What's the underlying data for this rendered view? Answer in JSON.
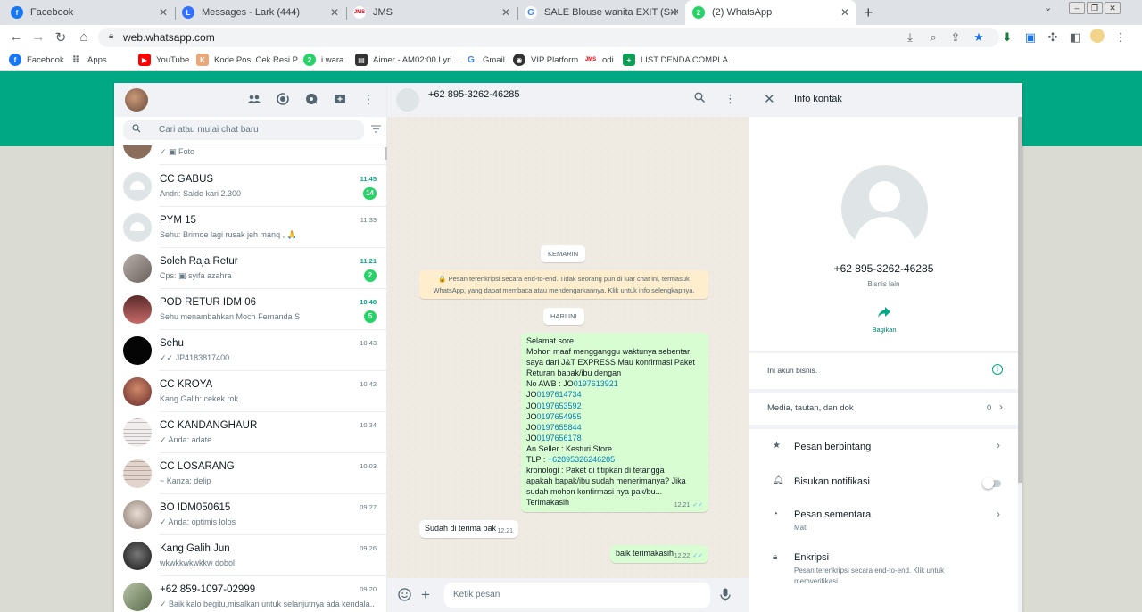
{
  "browser": {
    "tabs": [
      {
        "label": "Facebook",
        "favicon": "facebook-icon",
        "color": "#1877f2"
      },
      {
        "label": "Messages - Lark (444)",
        "favicon": "lark-icon",
        "color": "#3370ff"
      },
      {
        "label": "JMS",
        "favicon": "jms-icon",
        "color": "#e60012"
      },
      {
        "label": "SALE Blouse wanita EXIT (S-XXL),S",
        "favicon": "google-icon",
        "color": "#4285f4"
      },
      {
        "label": "(2) WhatsApp",
        "favicon": "whatsapp-icon",
        "color": "#25d366"
      }
    ],
    "url": "web.whatsapp.com",
    "bookmarks": [
      {
        "label": "Facebook",
        "icon": "facebook-icon",
        "color": "#1877f2"
      },
      {
        "label": "Apps",
        "icon": "apps-grid-icon",
        "color": "#5f6368"
      },
      {
        "label": "YouTube",
        "icon": "youtube-icon",
        "color": "#ff0000"
      },
      {
        "label": "Kode Pos, Cek Resi P...",
        "icon": "kodepos-icon",
        "color": "#e8a87c"
      },
      {
        "label": "i wara",
        "icon": "whatsapp-icon",
        "color": "#25d366"
      },
      {
        "label": "Aimer - AM02:00 Lyri...",
        "icon": "lyrics-icon",
        "color": "#333333"
      },
      {
        "label": "Gmail",
        "icon": "google-icon",
        "color": "#4285f4"
      },
      {
        "label": "VIP Platform",
        "icon": "vip-icon",
        "color": "#333333"
      },
      {
        "label": "odi",
        "icon": "jms-icon",
        "color": "#e60012"
      },
      {
        "label": "LIST DENDA COMPLA...",
        "icon": "sheets-icon",
        "color": "#0f9d58"
      }
    ]
  },
  "left": {
    "search_placeholder": "Cari atau mulai chat baru",
    "chats": [
      {
        "name": "",
        "message": "✓ ▣ Foto",
        "time": "",
        "unread": "",
        "avatar": "photo",
        "color": "#8a6d5a"
      },
      {
        "name": "CC GABUS",
        "message": "Andri: Saldo kari 2.300",
        "time": "11.45",
        "unread": "14",
        "avatar": "default",
        "color": "#dfe5e7"
      },
      {
        "name": "PYM 15",
        "message": "Sehu: Brimoe lagi rusak jeh manq , 🙏",
        "time": "11.33",
        "unread": "",
        "avatar": "default",
        "color": "#dfe5e7"
      },
      {
        "name": "Soleh Raja Retur",
        "message": "Cps: ▣ syifa azahra",
        "time": "11.21",
        "unread": "2",
        "avatar": "photo",
        "color": "#9a8f8c"
      },
      {
        "name": "POD RETUR IDM 06",
        "message": "Sehu menambahkan Moch Fernanda S",
        "time": "10.48",
        "unread": "5",
        "avatar": "photo",
        "color": "#7a3a3a"
      },
      {
        "name": "Sehu",
        "message": "✓✓ JP4183817400",
        "time": "10.43",
        "unread": "",
        "avatar": "photo",
        "color": "#050505"
      },
      {
        "name": "CC KROYA",
        "message": "Kang Galih: cekek rok",
        "time": "10.42",
        "unread": "",
        "avatar": "photo",
        "color": "#a0463c"
      },
      {
        "name": "CC KANDANGHAUR",
        "message": "✓ Anda: adate",
        "time": "10.34",
        "unread": "",
        "avatar": "photo",
        "color": "#d8d0d0"
      },
      {
        "name": "CC LOSARANG",
        "message": "~ Kanza: delip",
        "time": "10.03",
        "unread": "",
        "avatar": "photo",
        "color": "#cbb8b0"
      },
      {
        "name": "BO IDM050615",
        "message": "✓ Anda: optimis  lolos",
        "time": "09.27",
        "unread": "",
        "avatar": "photo",
        "color": "#c4b4a8"
      },
      {
        "name": "Kang Galih Jun",
        "message": "wkwkkwkwkkw dobol",
        "time": "09.26",
        "unread": "",
        "avatar": "photo",
        "color": "#2a2a2a"
      },
      {
        "name": "+62 859-1097-02999",
        "message": "✓ Baik kalo begitu,misalkan untuk selanjutnya ada kendala...",
        "time": "09.20",
        "unread": "",
        "avatar": "photo",
        "color": "#8a9a7a"
      }
    ]
  },
  "conversation": {
    "contact": "+62 895-3262-46285",
    "chip_yesterday": "KEMARIN",
    "chip_today": "HARI INI",
    "system_message": "🔒 Pesan terenkripsi secara end-to-end. Tidak seorang pun di luar chat ini, termasuk WhatsApp, yang dapat membaca atau mendengarkannya. Klik untuk info selengkapnya.",
    "messages": [
      {
        "direction": "out",
        "lines": [
          {
            "t": "Selamat sore"
          },
          {
            "t": "Mohon maaf mengganggu waktunya sebentar"
          },
          {
            "t": "saya dari J&T EXPRESS Mau konfirmasi Paket"
          },
          {
            "t": "Returan bapak/ibu dengan"
          },
          {
            "t": "No AWB : JO",
            "link": "0197613921"
          },
          {
            "t": "JO",
            "link": "0197614734"
          },
          {
            "t": "JO",
            "link": "0197653592"
          },
          {
            "t": "JO",
            "link": "0197654955"
          },
          {
            "t": "JO",
            "link": "0197655844"
          },
          {
            "t": "JO",
            "link": "0197656178"
          },
          {
            "t": "An Seller : Kesturi Store"
          },
          {
            "t": "TLP : ",
            "link": "+62895326246285"
          },
          {
            "t": "kronologi : Paket di titipkan di tetangga"
          },
          {
            "t": "apakah bapak/ibu sudah menerimanya? Jika"
          },
          {
            "t": "sudah mohon konfirmasi nya pak/bu..."
          },
          {
            "t": "Terimakasih"
          }
        ],
        "time": "12.21"
      },
      {
        "direction": "in",
        "text": "Sudah di terima pak",
        "time": "12.21"
      },
      {
        "direction": "out",
        "text": "baik terimakasih",
        "time": "12.22"
      }
    ],
    "composer_placeholder": "Ketik pesan"
  },
  "info": {
    "title": "Info kontak",
    "phone": "+62 895-3262-46285",
    "subtitle": "Bisnis lain",
    "share_label": "Bagikan",
    "business_note": "Ini akun bisnis.",
    "media_label": "Media, tautan, dan dok",
    "media_count": "0",
    "starred": "Pesan berbintang",
    "mute": "Bisukan notifikasi",
    "mute_enabled": false,
    "disappearing": "Pesan sementara",
    "disappearing_value": "Mati",
    "encryption": "Enkripsi",
    "encryption_desc_1": "Pesan terenkripsi secara end-to-end. Klik untuk",
    "encryption_desc_2": "memverifikasi."
  }
}
